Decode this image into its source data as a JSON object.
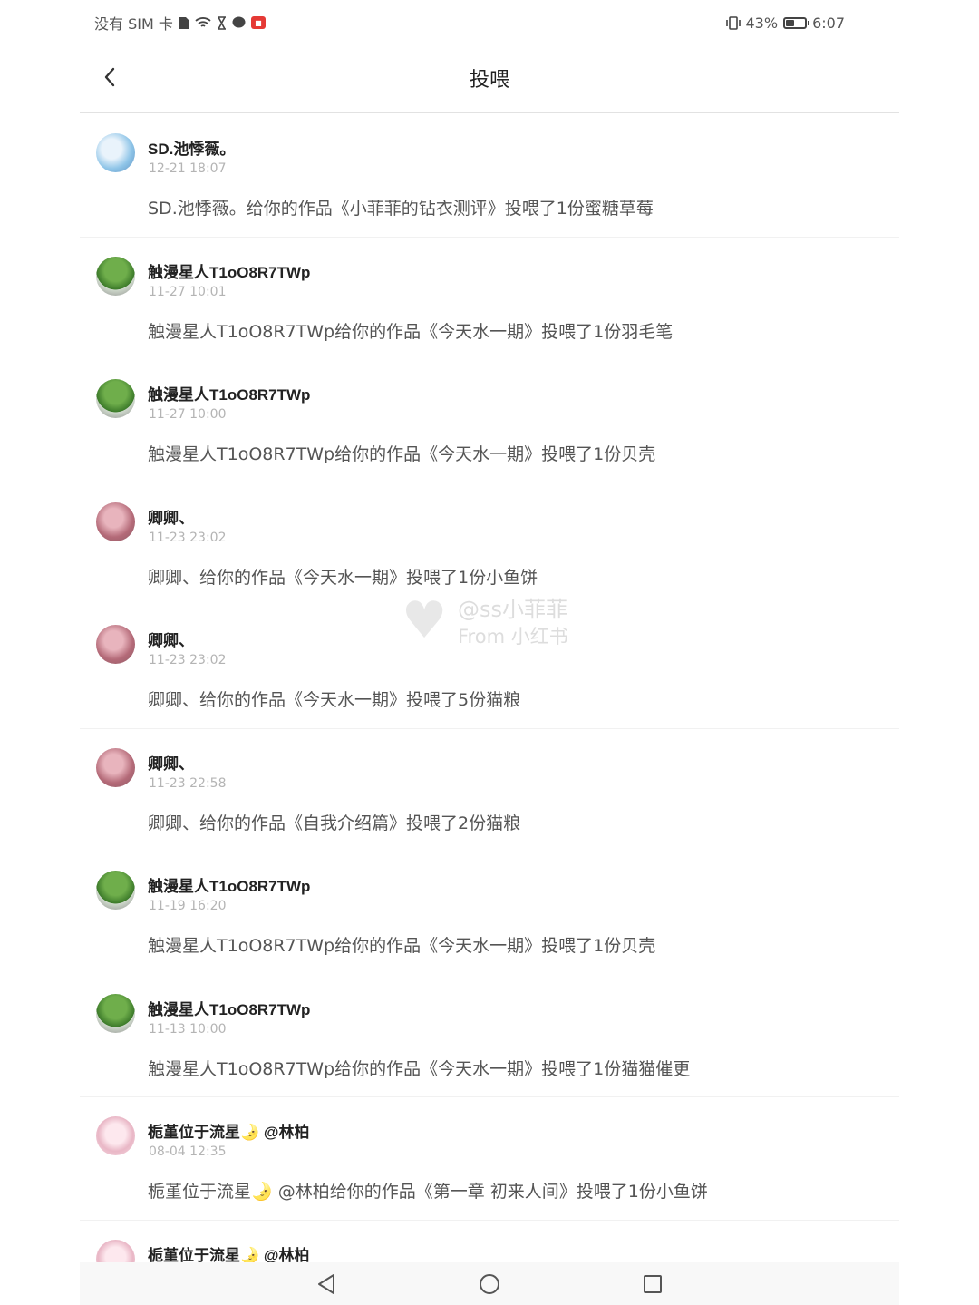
{
  "status_bar": {
    "carrier": "没有 SIM 卡",
    "battery_percent": "43%",
    "battery_level": 0.43,
    "time": "6:07",
    "icons": [
      "sim-card-icon",
      "wifi-icon",
      "hourglass-icon",
      "chat-bubble-icon",
      "red-app-icon",
      "vibrate-icon",
      "battery-icon"
    ]
  },
  "header": {
    "title": "投喂",
    "back_icon": "chevron-left-icon"
  },
  "items": [
    {
      "name": "SD.池悸薇。",
      "time": "12-21 18:07",
      "message": "SD.池悸薇。给你的作品《小菲菲的钻衣测评》投喂了1份蜜糖草莓",
      "avatar": "blue"
    },
    {
      "name": "触漫星人T1oO8R7TWp",
      "time": "11-27 10:01",
      "message": "触漫星人T1oO8R7TWp给你的作品《今天水一期》投喂了1份羽毛笔",
      "avatar": "green"
    },
    {
      "name": "触漫星人T1oO8R7TWp",
      "time": "11-27 10:00",
      "message": "触漫星人T1oO8R7TWp给你的作品《今天水一期》投喂了1份贝壳",
      "avatar": "green"
    },
    {
      "name": "卿卿、",
      "time": "11-23 23:02",
      "message": "卿卿、给你的作品《今天水一期》投喂了1份小鱼饼",
      "avatar": "pink"
    },
    {
      "name": "卿卿、",
      "time": "11-23 23:02",
      "message": "卿卿、给你的作品《今天水一期》投喂了5份猫粮",
      "avatar": "pink"
    },
    {
      "name": "卿卿、",
      "time": "11-23 22:58",
      "message": "卿卿、给你的作品《自我介绍篇》投喂了2份猫粮",
      "avatar": "pink"
    },
    {
      "name": "触漫星人T1oO8R7TWp",
      "time": "11-19 16:20",
      "message": "触漫星人T1oO8R7TWp给你的作品《今天水一期》投喂了1份贝壳",
      "avatar": "green"
    },
    {
      "name": "触漫星人T1oO8R7TWp",
      "time": "11-13 10:00",
      "message": "触漫星人T1oO8R7TWp给你的作品《今天水一期》投喂了1份猫猫催更",
      "avatar": "green"
    },
    {
      "name": "栀堇位于流星🌛 @林柏",
      "time": "08-04 12:35",
      "message": "栀堇位于流星🌛 @林柏给你的作品《第一章 初来人间》投喂了1份小鱼饼",
      "avatar": "anime"
    },
    {
      "name": "栀堇位于流星🌛 @林柏",
      "time": "",
      "message": "",
      "avatar": "anime"
    }
  ],
  "watermark": {
    "line1": "@ss小菲菲",
    "line2": "From 小红书"
  },
  "nav_bar": {
    "icons": [
      "back-triangle-icon",
      "home-circle-icon",
      "recents-square-icon"
    ]
  }
}
